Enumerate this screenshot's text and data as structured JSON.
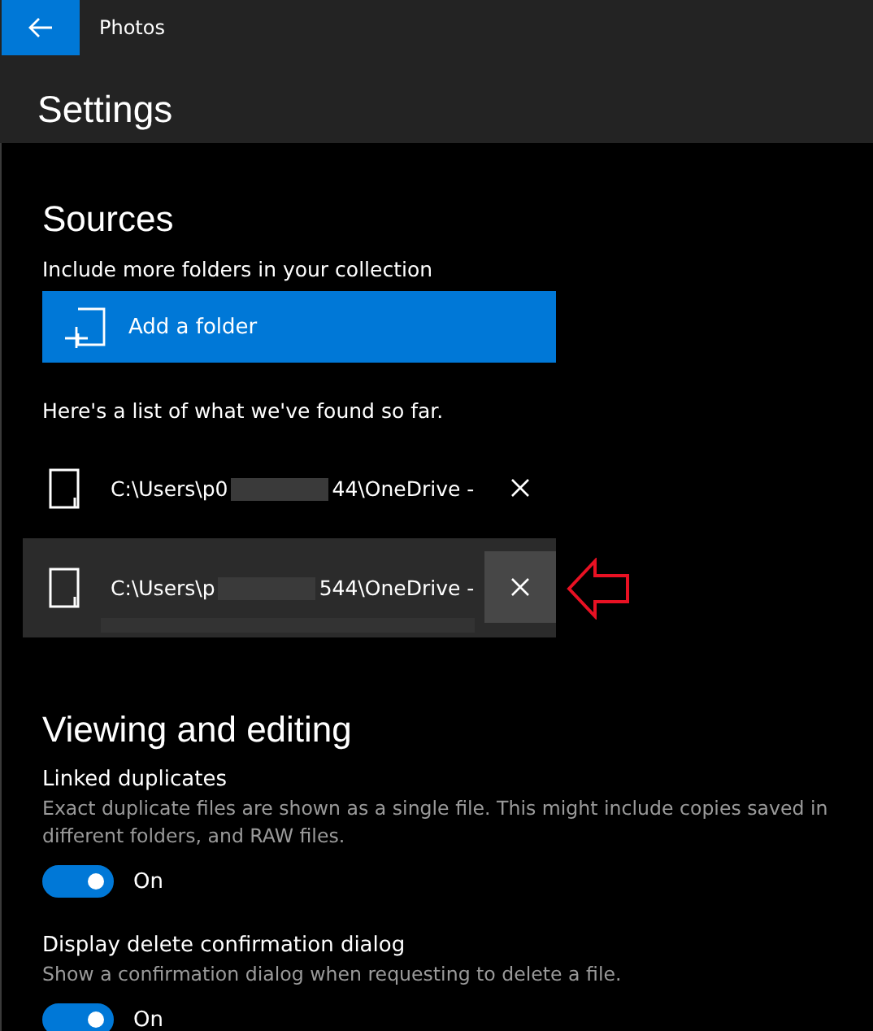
{
  "window": {
    "title": "Photos"
  },
  "page_title": "Settings",
  "sources": {
    "heading": "Sources",
    "include_label": "Include more folders in your collection",
    "add_button": "Add a folder",
    "found_label": "Here's a list of what we've found so far.",
    "folders": [
      {
        "path_start": "C:\\Users\\p0",
        "path_end": "44\\OneDrive -",
        "hovered": false
      },
      {
        "path_start": "C:\\Users\\p",
        "path_end": "544\\OneDrive -",
        "hovered": true
      }
    ]
  },
  "viewing": {
    "heading": "Viewing and editing",
    "settings": [
      {
        "title": "Linked duplicates",
        "description": "Exact duplicate files are shown as a single file. This might include copies saved in different folders, and RAW files.",
        "on": true,
        "state_label": "On"
      },
      {
        "title": "Display delete confirmation dialog",
        "description": "Show a confirmation dialog when requesting to delete a file.",
        "on": true,
        "state_label": "On"
      }
    ]
  }
}
